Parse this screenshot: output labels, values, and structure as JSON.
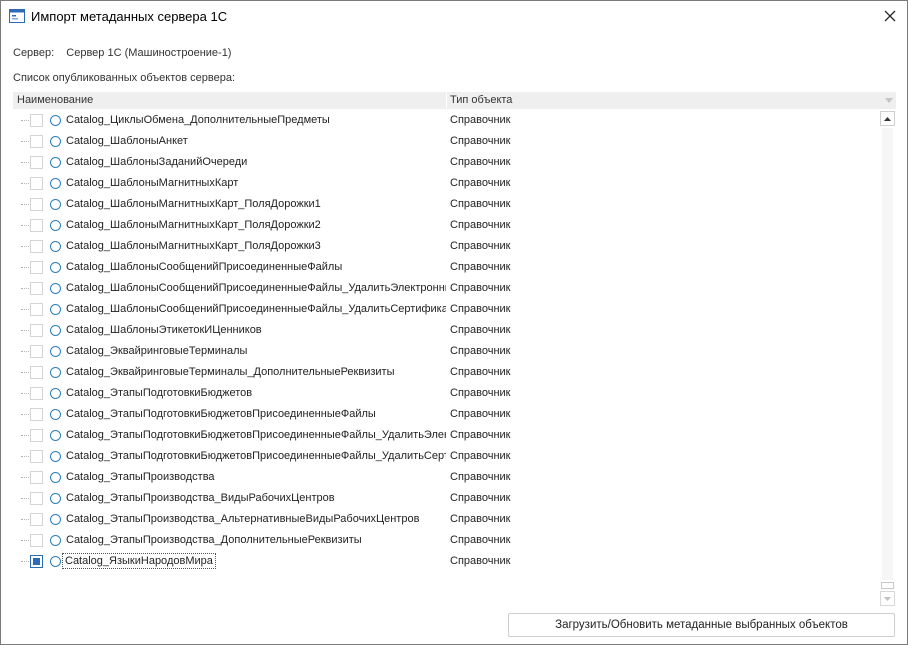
{
  "window": {
    "title": "Импорт метаданных сервера 1С"
  },
  "server": {
    "label": "Сервер:",
    "value": "Сервер 1С (Машиностроение-1)"
  },
  "list_caption": "Список опубликованных объектов сервера:",
  "grid": {
    "columns": [
      "Наименование",
      "Тип объекта"
    ],
    "rows": [
      {
        "name": "Catalog_ЦиклыОбмена_ДополнительныеПредметы",
        "type": "Справочник",
        "checked": false
      },
      {
        "name": "Catalog_ШаблоныАнкет",
        "type": "Справочник",
        "checked": false
      },
      {
        "name": "Catalog_ШаблоныЗаданийОчереди",
        "type": "Справочник",
        "checked": false
      },
      {
        "name": "Catalog_ШаблоныМагнитныхКарт",
        "type": "Справочник",
        "checked": false
      },
      {
        "name": "Catalog_ШаблоныМагнитныхКарт_ПоляДорожки1",
        "type": "Справочник",
        "checked": false
      },
      {
        "name": "Catalog_ШаблоныМагнитныхКарт_ПоляДорожки2",
        "type": "Справочник",
        "checked": false
      },
      {
        "name": "Catalog_ШаблоныМагнитныхКарт_ПоляДорожки3",
        "type": "Справочник",
        "checked": false
      },
      {
        "name": "Catalog_ШаблоныСообщенийПрисоединенныеФайлы",
        "type": "Справочник",
        "checked": false
      },
      {
        "name": "Catalog_ШаблоныСообщенийПрисоединенныеФайлы_УдалитьЭлектронные",
        "type": "Справочник",
        "checked": false
      },
      {
        "name": "Catalog_ШаблоныСообщенийПрисоединенныеФайлы_УдалитьСертификаты",
        "type": "Справочник",
        "checked": false
      },
      {
        "name": "Catalog_ШаблоныЭтикетокИЦенников",
        "type": "Справочник",
        "checked": false
      },
      {
        "name": "Catalog_ЭквайринговыеТерминалы",
        "type": "Справочник",
        "checked": false
      },
      {
        "name": "Catalog_ЭквайринговыеТерминалы_ДополнительныеРеквизиты",
        "type": "Справочник",
        "checked": false
      },
      {
        "name": "Catalog_ЭтапыПодготовкиБюджетов",
        "type": "Справочник",
        "checked": false
      },
      {
        "name": "Catalog_ЭтапыПодготовкиБюджетовПрисоединенныеФайлы",
        "type": "Справочник",
        "checked": false
      },
      {
        "name": "Catalog_ЭтапыПодготовкиБюджетовПрисоединенныеФайлы_УдалитьЭлектронные",
        "type": "Справочник",
        "checked": false
      },
      {
        "name": "Catalog_ЭтапыПодготовкиБюджетовПрисоединенныеФайлы_УдалитьСертификаты",
        "type": "Справочник",
        "checked": false
      },
      {
        "name": "Catalog_ЭтапыПроизводства",
        "type": "Справочник",
        "checked": false
      },
      {
        "name": "Catalog_ЭтапыПроизводства_ВидыРабочихЦентров",
        "type": "Справочник",
        "checked": false
      },
      {
        "name": "Catalog_ЭтапыПроизводства_АльтернативныеВидыРабочихЦентров",
        "type": "Справочник",
        "checked": false
      },
      {
        "name": "Catalog_ЭтапыПроизводства_ДополнительныеРеквизиты",
        "type": "Справочник",
        "checked": false
      },
      {
        "name": "Catalog_ЯзыкиНародовМира",
        "type": "Справочник",
        "checked": true,
        "selected": true
      }
    ]
  },
  "load_button": "Загрузить/Обновить метаданные выбранных объектов",
  "icons": {
    "app": "window-icon",
    "close": "close-icon",
    "row_object": "circle-icon",
    "scroll_up": "chevron-up-icon",
    "scroll_down": "chevron-down-icon",
    "header_menu": "triangle-down-icon"
  },
  "colors": {
    "accent": "#2d6cb5",
    "object_icon": "#2c7fb8",
    "header_bg": "#efefef"
  }
}
